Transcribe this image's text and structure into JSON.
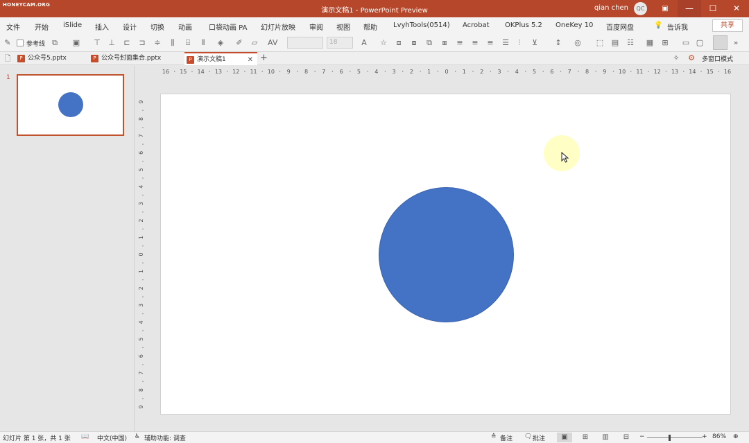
{
  "watermark": "HONEYCAM.ORG",
  "window": {
    "title": "演示文稿1  -  PowerPoint Preview",
    "user_name": "qian chen",
    "user_initials": "QC",
    "min_glyph": "—",
    "max_glyph": "☐",
    "close_glyph": "✕"
  },
  "menu": {
    "items": [
      "文件",
      "开始",
      "iSlide",
      "插入",
      "设计",
      "切换",
      "动画",
      "口袋动画 PA",
      "幻灯片放映",
      "审阅",
      "视图",
      "帮助",
      "LvyhTools(0514)",
      "Acrobat",
      "OKPlus 5.2",
      "OneKey 10",
      "百度网盘"
    ],
    "tell_me": "告诉我",
    "share": "共享"
  },
  "toolbar": {
    "reference_line_label": "参考线",
    "font_size_value": "18"
  },
  "doc_tabs": {
    "tabs": [
      {
        "label": "公众号5.pptx"
      },
      {
        "label": "公众号封面集合.pptx"
      },
      {
        "label": "演示文稿1"
      }
    ],
    "multi_window": "多窗口模式"
  },
  "thumbnails": {
    "slide_number": "1"
  },
  "ruler": {
    "h_labels": [
      "16",
      "15",
      "14",
      "13",
      "12",
      "11",
      "10",
      "9",
      "8",
      "7",
      "6",
      "5",
      "4",
      "3",
      "2",
      "1",
      "0",
      "1",
      "2",
      "3",
      "4",
      "5",
      "6",
      "7",
      "8",
      "9",
      "10",
      "11",
      "12",
      "13",
      "14",
      "15",
      "16"
    ],
    "v_labels": [
      "9",
      "8",
      "7",
      "6",
      "5",
      "4",
      "3",
      "2",
      "1",
      "0",
      "1",
      "2",
      "3",
      "4",
      "5",
      "6",
      "7",
      "8",
      "9"
    ]
  },
  "status": {
    "slide_info": "幻灯片 第 1 张，共 1 张",
    "language": "中文(中国)",
    "accessibility": "辅助功能: 调查",
    "notes": "备注",
    "comments": "批注",
    "zoom": "86%"
  },
  "colors": {
    "accent": "#b7472a",
    "shape_fill": "#4472c4"
  }
}
